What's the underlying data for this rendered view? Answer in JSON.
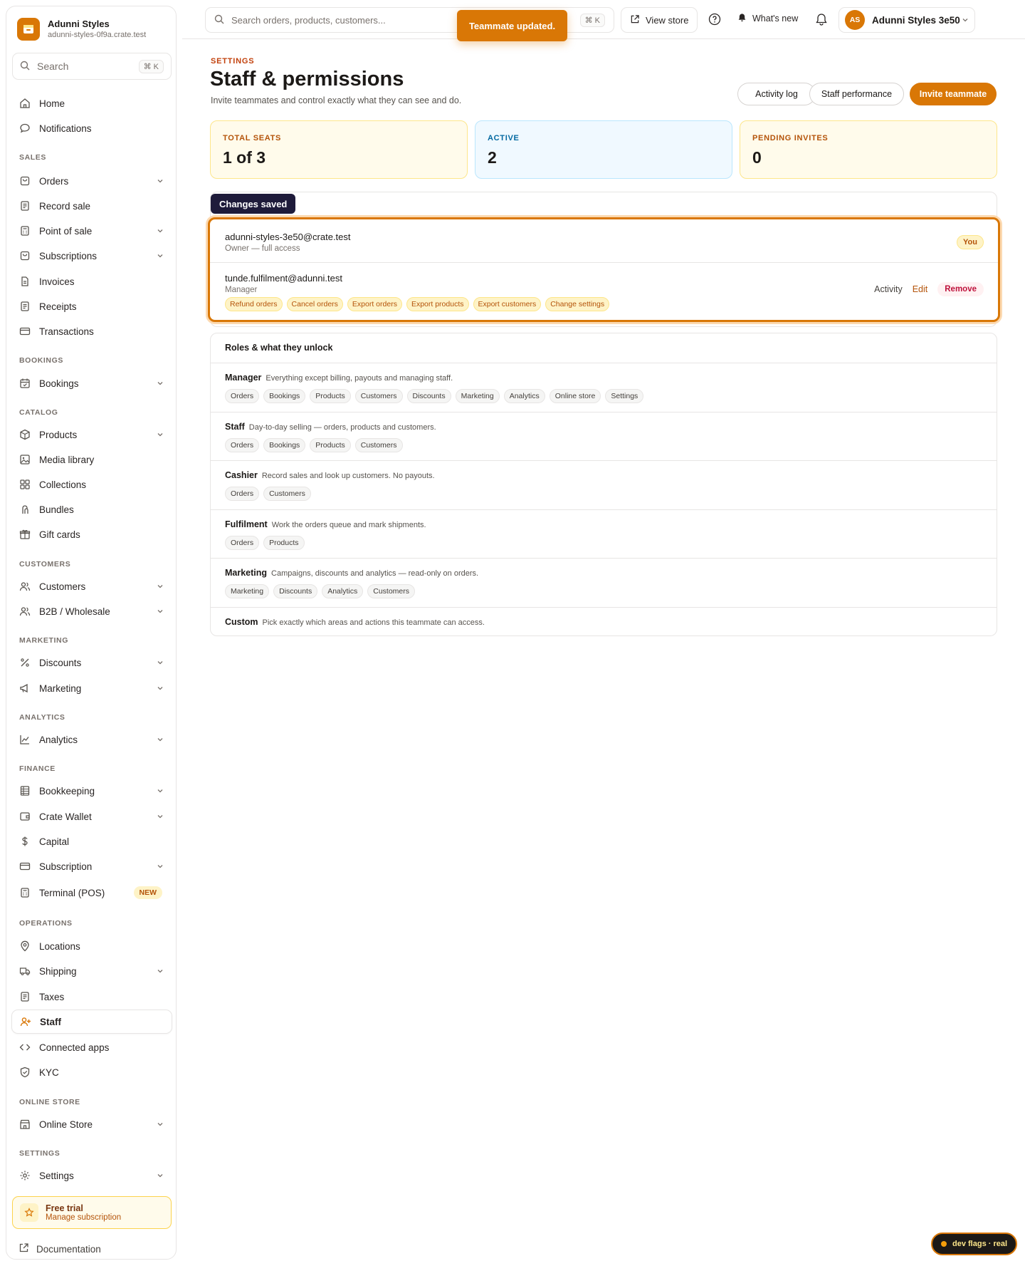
{
  "brand": {
    "name": "Adunni Styles",
    "subdomain": "adunni-styles-0f9a.crate.test"
  },
  "sidebar": {
    "search_placeholder": "Search",
    "search_kbd": "⌘ K",
    "top_items": [
      {
        "label": "Home",
        "icon": "home-icon"
      },
      {
        "label": "Notifications",
        "icon": "chat-bubble-icon"
      }
    ],
    "sections": {
      "sales": "SALES",
      "bookings": "BOOKINGS",
      "catalog": "CATALOG",
      "customers": "CUSTOMERS",
      "marketing": "MARKETING",
      "analytics": "ANALYTICS",
      "finance": "FINANCE",
      "operations": "OPERATIONS",
      "online_store": "ONLINE STORE",
      "settings": "SETTINGS"
    },
    "items": {
      "orders": "Orders",
      "record_sale": "Record sale",
      "point_of_sale": "Point of sale",
      "subscriptions": "Subscriptions",
      "invoices": "Invoices",
      "receipts": "Receipts",
      "transactions": "Transactions",
      "bookings": "Bookings",
      "products": "Products",
      "media_library": "Media library",
      "collections": "Collections",
      "bundles": "Bundles",
      "gift_cards": "Gift cards",
      "customers": "Customers",
      "b2b": "B2B / Wholesale",
      "discounts": "Discounts",
      "marketing": "Marketing",
      "analytics": "Analytics",
      "bookkeeping": "Bookkeeping",
      "crate_wallet": "Crate Wallet",
      "capital": "Capital",
      "subscription": "Subscription",
      "terminal": "Terminal (POS)",
      "terminal_badge": "NEW",
      "locations": "Locations",
      "shipping": "Shipping",
      "taxes": "Taxes",
      "staff": "Staff",
      "connected_apps": "Connected apps",
      "kyc": "KYC",
      "online_store": "Online Store",
      "settings": "Settings"
    },
    "trial": {
      "title": "Free trial",
      "link": "Manage subscription"
    },
    "documentation": "Documentation"
  },
  "topbar": {
    "search_placeholder": "Search orders, products, customers...",
    "search_kbd": "⌘ K",
    "view_store": "View store",
    "whats_new": "What's new",
    "account_initials": "AS",
    "account_name": "Adunni Styles 3e50"
  },
  "toast": "Teammate updated.",
  "page": {
    "eyebrow": "SETTINGS",
    "title": "Staff & permissions",
    "subtitle": "Invite teammates and control exactly what they can see and do.",
    "buttons": {
      "activity_log": "Activity log",
      "staff_performance": "Staff performance",
      "invite": "Invite teammate"
    }
  },
  "stats": [
    {
      "label": "TOTAL SEATS",
      "value": "1 of 3"
    },
    {
      "label": "ACTIVE",
      "value": "2"
    },
    {
      "label": "PENDING INVITES",
      "value": "0"
    }
  ],
  "saved_pill": "Changes saved",
  "members": [
    {
      "email": "adunni-styles-3e50@crate.test",
      "role": "Owner — full access",
      "badge": "You"
    },
    {
      "email": "tunde.fulfilment@adunni.test",
      "role": "Manager",
      "permissions": [
        "Refund orders",
        "Cancel orders",
        "Export orders",
        "Export products",
        "Export customers",
        "Change settings"
      ],
      "actions": {
        "activity": "Activity",
        "edit": "Edit",
        "remove": "Remove"
      }
    }
  ],
  "roles": {
    "heading": "Roles & what they unlock",
    "items": [
      {
        "name": "Manager",
        "desc": "Everything except billing, payouts and managing staff.",
        "tags": [
          "Orders",
          "Bookings",
          "Products",
          "Customers",
          "Discounts",
          "Marketing",
          "Analytics",
          "Online store",
          "Settings"
        ]
      },
      {
        "name": "Staff",
        "desc": "Day-to-day selling — orders, products and customers.",
        "tags": [
          "Orders",
          "Bookings",
          "Products",
          "Customers"
        ]
      },
      {
        "name": "Cashier",
        "desc": "Record sales and look up customers. No payouts.",
        "tags": [
          "Orders",
          "Customers"
        ]
      },
      {
        "name": "Fulfilment",
        "desc": "Work the orders queue and mark shipments.",
        "tags": [
          "Orders",
          "Products"
        ]
      },
      {
        "name": "Marketing",
        "desc": "Campaigns, discounts and analytics — read-only on orders.",
        "tags": [
          "Marketing",
          "Discounts",
          "Analytics",
          "Customers"
        ]
      },
      {
        "name": "Custom",
        "desc": "Pick exactly which areas and actions this teammate can access.",
        "tags": []
      }
    ]
  },
  "dev_flags": "dev flags · real",
  "colors": {
    "accent": "#d97706",
    "accent_dark": "#b45309",
    "remove": "#be123c",
    "info": "#0369a1"
  }
}
